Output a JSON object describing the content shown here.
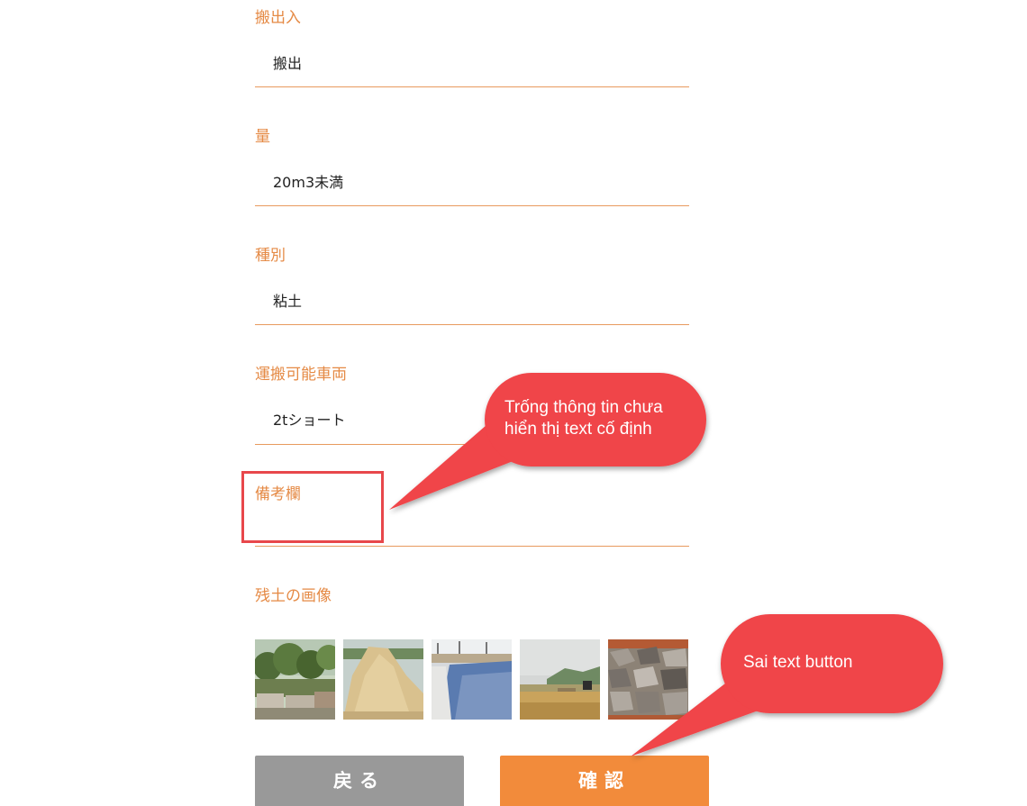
{
  "form": {
    "fields": [
      {
        "label": "搬出入",
        "value": "搬出"
      },
      {
        "label": "量",
        "value": "20m3未満"
      },
      {
        "label": "種別",
        "value": "粘土"
      },
      {
        "label": "運搬可能車両",
        "value": "2tショート"
      },
      {
        "label": "備考欄",
        "value": ""
      }
    ],
    "images_label": "残土の画像",
    "images": [
      {
        "name": "stacked-stones-with-trees"
      },
      {
        "name": "sand-pile"
      },
      {
        "name": "gravel-construction-site"
      },
      {
        "name": "dirt-field-with-machine"
      },
      {
        "name": "rubble-stones"
      }
    ]
  },
  "buttons": {
    "back_label": "戻る",
    "confirm_label": "確認"
  },
  "annotations": {
    "callout_1": {
      "line1": "Trống thông tin chưa",
      "line2": "hiển thị text cố định"
    },
    "callout_2": {
      "text": "Sai text button"
    },
    "colors": {
      "callout": "#f04448",
      "accent": "#e58a45",
      "confirm": "#f28b3b",
      "back": "#999999"
    }
  }
}
